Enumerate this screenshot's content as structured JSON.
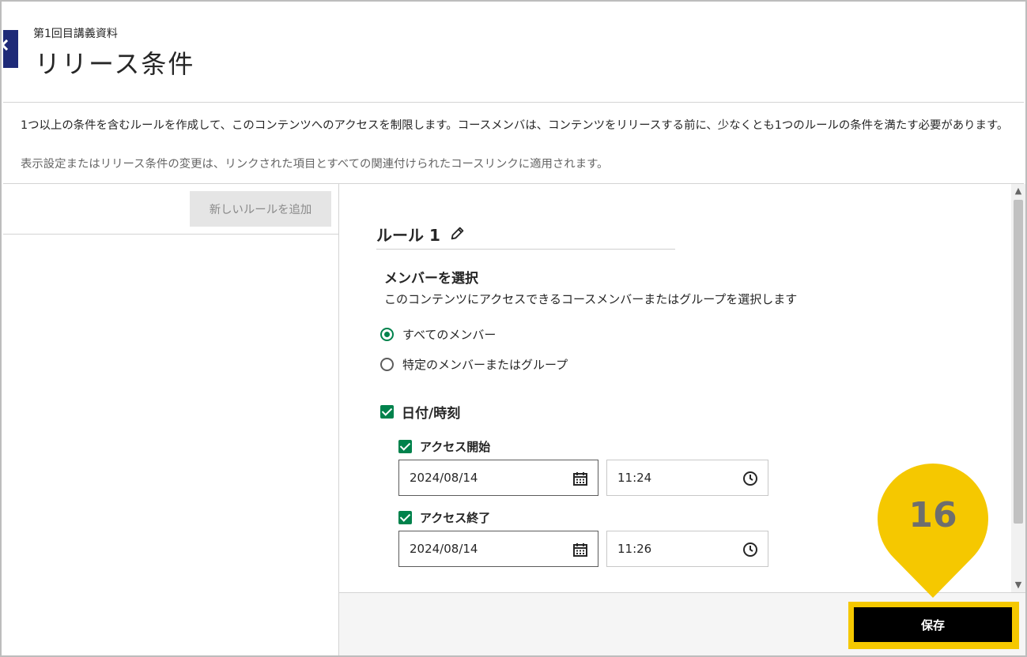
{
  "header": {
    "breadcrumb": "第1回目講義資料",
    "title": "リリース条件"
  },
  "description": {
    "main": "1つ以上の条件を含むルールを作成して、このコンテンツへのアクセスを制限します。コースメンバは、コンテンツをリリースする前に、少なくとも1つのルールの条件を満たす必要があります。",
    "sub": "表示設定またはリリース条件の変更は、リンクされた項目とすべての関連付けられたコースリンクに適用されます。"
  },
  "left_pane": {
    "add_rule_label": "新しいルールを追加"
  },
  "rule": {
    "title": "ルール 1",
    "member_section": {
      "title": "メンバーを選択",
      "description": "このコンテンツにアクセスできるコースメンバーまたはグループを選択します",
      "options": [
        {
          "label": "すべてのメンバー",
          "selected": true
        },
        {
          "label": "特定のメンバーまたはグループ",
          "selected": false
        }
      ]
    },
    "date_time": {
      "label": "日付/時刻",
      "checked": true,
      "start": {
        "label": "アクセス開始",
        "checked": true,
        "date": "2024/08/14",
        "time": "11:24"
      },
      "end": {
        "label": "アクセス終了",
        "checked": true,
        "date": "2024/08/14",
        "time": "11:26"
      }
    }
  },
  "footer": {
    "save_label": "保存"
  },
  "callout": {
    "number": "16"
  },
  "colors": {
    "accent_green": "#00824c",
    "callout_yellow": "#f5c800",
    "back_tab_navy": "#1e2a78"
  }
}
